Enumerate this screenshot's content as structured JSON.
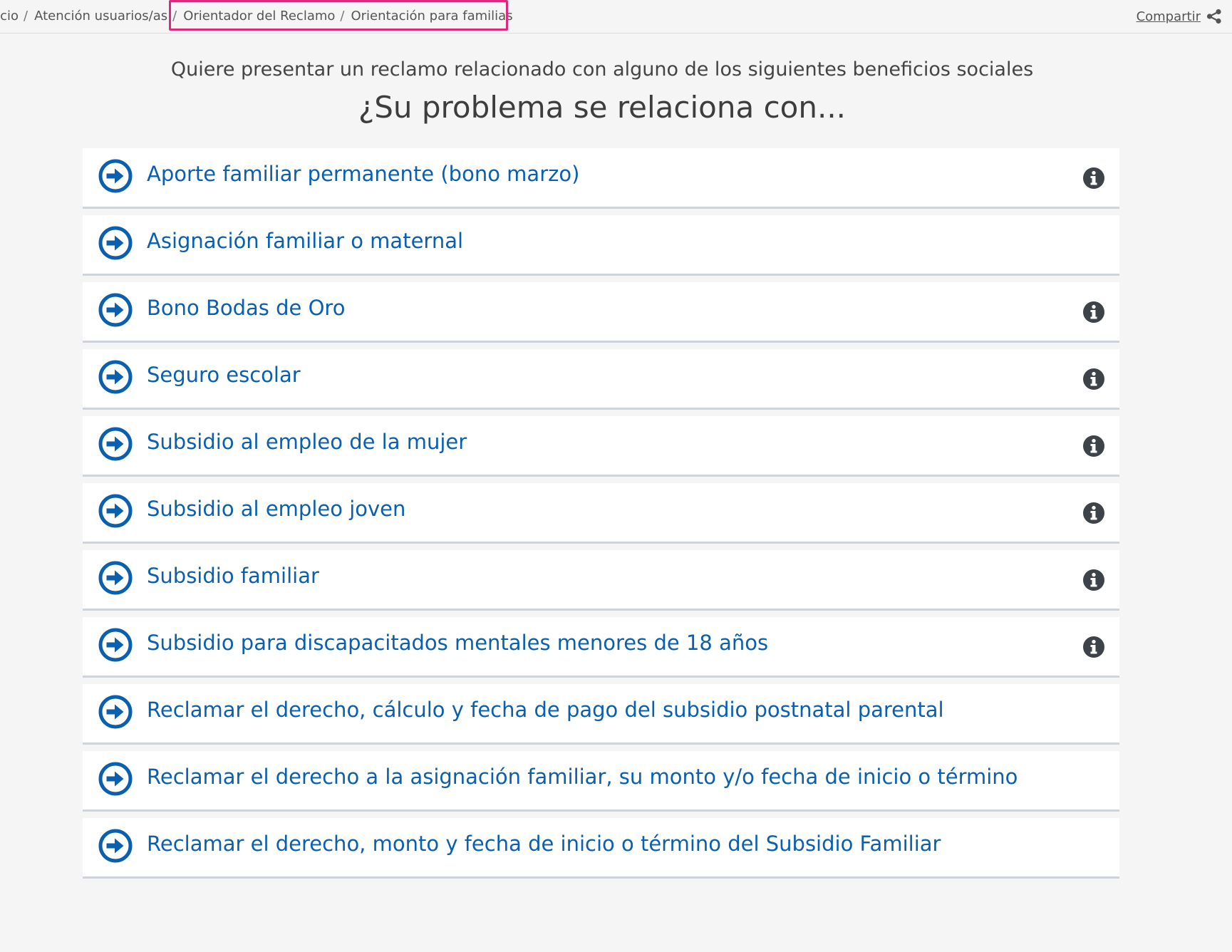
{
  "breadcrumb": {
    "items": [
      {
        "label": "Inicio"
      },
      {
        "label": "Atención usuarios/as"
      },
      {
        "label": "Orientador del Reclamo"
      },
      {
        "label": "Orientación para familias"
      }
    ],
    "separator": "/"
  },
  "share": {
    "label": "Compartir",
    "icon": "share-icon"
  },
  "intro": "Quiere presentar un reclamo relacionado con alguno de los siguientes beneficios sociales",
  "question": "¿Su problema se relaciona con...",
  "colors": {
    "link": "#0a5fae",
    "icon_blue": "#0a5fae",
    "info_icon": "#3d4349",
    "highlight": "#e0287d",
    "row_border": "#cfd4da"
  },
  "options": [
    {
      "label": "Aporte familiar permanente (bono marzo)",
      "icon": "arrow-right-circle-icon",
      "info": true
    },
    {
      "label": "Asignación familiar o maternal",
      "icon": "arrow-right-circle-icon",
      "info": false
    },
    {
      "label": "Bono Bodas de Oro",
      "icon": "arrow-right-circle-icon",
      "info": true
    },
    {
      "label": "Seguro escolar",
      "icon": "arrow-right-circle-icon",
      "info": true
    },
    {
      "label": "Subsidio al empleo de la mujer",
      "icon": "arrow-right-circle-icon",
      "info": true
    },
    {
      "label": "Subsidio al empleo joven",
      "icon": "arrow-right-circle-icon",
      "info": true
    },
    {
      "label": "Subsidio familiar",
      "icon": "arrow-right-circle-icon",
      "info": true
    },
    {
      "label": "Subsidio para discapacitados mentales menores de 18 años",
      "icon": "arrow-right-circle-icon",
      "info": true
    },
    {
      "label": "Reclamar el derecho, cálculo y fecha de pago del subsidio postnatal parental",
      "icon": "arrow-right-circle-icon",
      "info": false
    },
    {
      "label": "Reclamar el derecho a la asignación familiar, su monto y/o fecha de inicio o término",
      "icon": "arrow-right-circle-icon",
      "info": false
    },
    {
      "label": "Reclamar el derecho, monto y fecha de inicio o término del Subsidio Familiar",
      "icon": "arrow-right-circle-icon",
      "info": false
    }
  ]
}
